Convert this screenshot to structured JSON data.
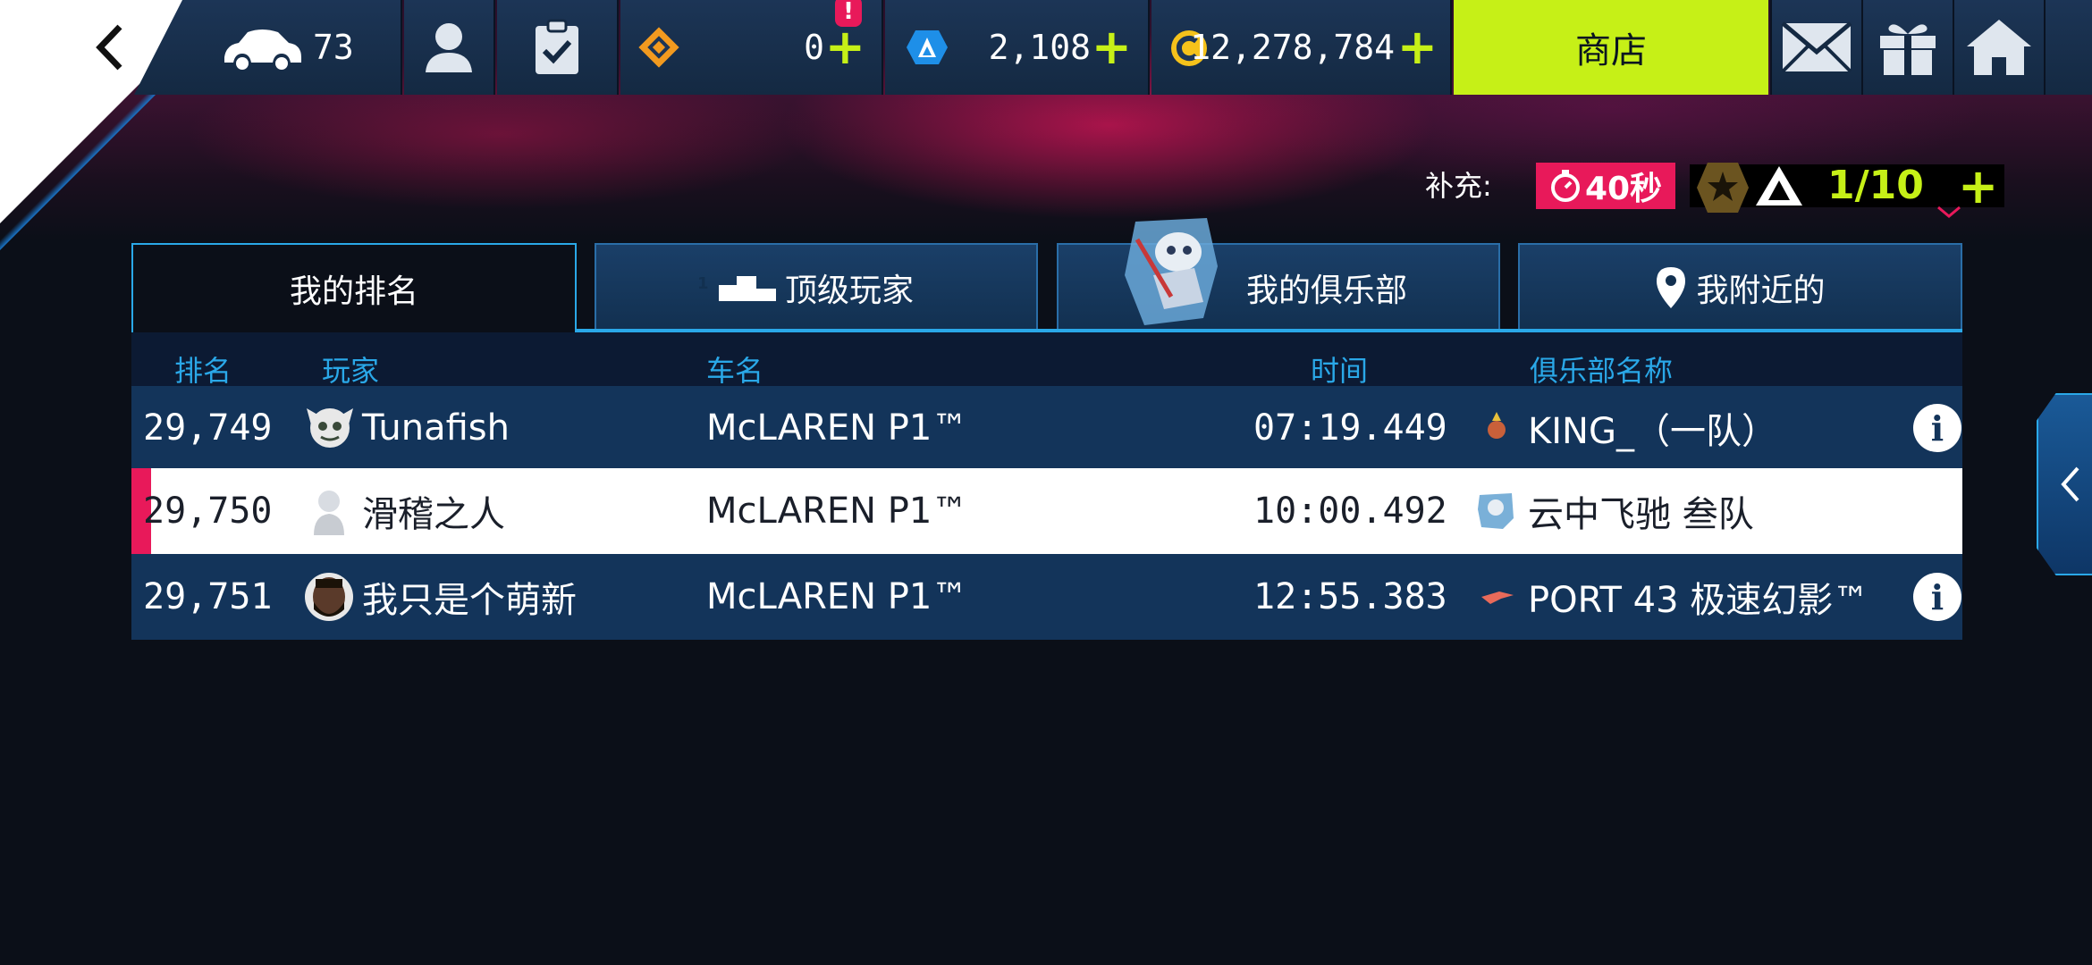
{
  "topbar": {
    "car_count": "73",
    "stat1_value": "0",
    "stat1_badge": "!",
    "stat2_value": "2,108",
    "credits_value": "12,278,784",
    "shop_label": "商店"
  },
  "refill": {
    "label": "补充:",
    "timer": "40秒",
    "counter": "1/10"
  },
  "tabs": [
    {
      "label": "我的排名",
      "active": true
    },
    {
      "label": "顶级玩家",
      "active": false
    },
    {
      "label": "我的俱乐部",
      "active": false
    },
    {
      "label": "我附近的",
      "active": false
    }
  ],
  "top_players_icon_number": "1",
  "table": {
    "headers": {
      "rank": "排名",
      "player": "玩家",
      "car": "车名",
      "time": "时间",
      "club": "俱乐部名称"
    },
    "rows": [
      {
        "rank": "29,749",
        "player": "Tunafish",
        "car": "McLAREN P1™",
        "time": "07:19.449",
        "club": "KING_（一队）",
        "highlight": false
      },
      {
        "rank": "29,750",
        "player": "滑稽之人",
        "car": "McLAREN P1™",
        "time": "10:00.492",
        "club": "云中飞驰 叁队",
        "highlight": true
      },
      {
        "rank": "29,751",
        "player": "我只是个萌新",
        "car": "McLAREN P1™",
        "time": "12:55.383",
        "club": "PORT 43 极速幻影™",
        "highlight": false
      }
    ]
  },
  "colors": {
    "accent": "#c6f017",
    "tab_border": "#2aa8e8",
    "timer_bg": "#e8195a",
    "highlight_bar": "#e8195a"
  },
  "icons": [
    "back-chevron-icon",
    "car-icon",
    "profile-icon",
    "clipboard-check-icon",
    "diamond-token-icon",
    "asphalt-token-icon",
    "credits-coin-icon",
    "mail-icon",
    "gift-icon",
    "home-icon",
    "stopwatch-icon",
    "star-badge-icon",
    "podium-icon",
    "location-pin-icon",
    "info-icon",
    "chevron-left-icon"
  ]
}
